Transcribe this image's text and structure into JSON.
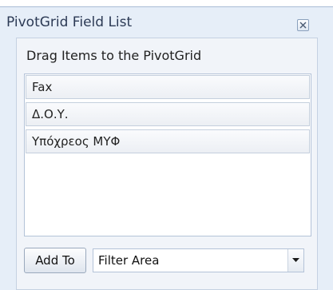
{
  "window": {
    "title": "PivotGrid Field List",
    "close_icon": "close-icon"
  },
  "panel": {
    "header": "Drag Items to the PivotGrid",
    "fields": [
      {
        "label": "Fax"
      },
      {
        "label": "Δ.Ο.Υ."
      },
      {
        "label": "Υπόχρεος ΜΥΦ"
      }
    ]
  },
  "footer": {
    "add_to_label": "Add To",
    "area_select": {
      "selected": "Filter Area",
      "icon": "chevron-down-icon"
    }
  },
  "colors": {
    "window_bg": "#e6eef8",
    "panel_bg": "#f1f4f9",
    "border": "#b4c3d8",
    "title_text": "#2c3a55"
  }
}
